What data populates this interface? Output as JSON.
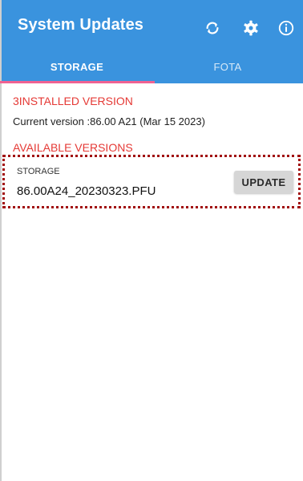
{
  "app": {
    "title": "System Updates",
    "accent_color": "#3a93de",
    "indicator_color": "#f06292",
    "header_color": "#e53935"
  },
  "actions": [
    {
      "name": "refresh-icon"
    },
    {
      "name": "gear-icon"
    },
    {
      "name": "info-icon"
    }
  ],
  "tabs": [
    {
      "label": "STORAGE",
      "active": true
    },
    {
      "label": "FOTA",
      "active": false
    }
  ],
  "installed": {
    "header": "3INSTALLED VERSION",
    "current": "Current version :86.00 A21 (Mar 15 2023)"
  },
  "available": {
    "header": "AVAILABLE VERSIONS",
    "items": [
      {
        "source": "STORAGE",
        "file": "86.00A24_20230323.PFU",
        "button": "UPDATE"
      }
    ]
  }
}
